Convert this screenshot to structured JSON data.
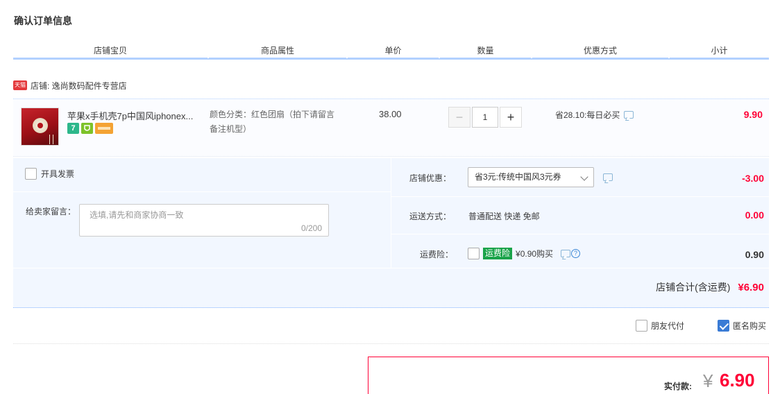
{
  "page_title": "确认订单信息",
  "table_headers": [
    "店铺宝贝",
    "商品属性",
    "单价",
    "数量",
    "优惠方式",
    "小计"
  ],
  "shop": {
    "badge": "天猫",
    "label": "店铺: 逸尚数码配件专营店"
  },
  "item": {
    "title": "苹果x手机壳7p中国风iphonex...",
    "attr_line1": "颜色分类：红色团扇（拍下请留言",
    "attr_line2": "备注机型）",
    "price": "38.00",
    "quantity": "1",
    "minus": "−",
    "plus": "+",
    "promo": "省28.10:每日必买",
    "subtotal": "9.90",
    "icons": [
      "seven-day-return-icon",
      "guarantee-icon",
      "credit-card-icon"
    ],
    "icon_seven_text": "7"
  },
  "invoice_label": "开具发票",
  "message": {
    "label": "给卖家留言：",
    "placeholder": "选填,请先和商家协商一致",
    "counter": "0/200"
  },
  "shop_discount": {
    "label": "店铺优惠：",
    "selected": "省3元:传统中国风3元券",
    "value": "-3.00"
  },
  "shipping": {
    "label": "运送方式：",
    "method": "普通配送 快递 免邮",
    "value": "0.00"
  },
  "insurance": {
    "label": "运费险：",
    "tag": "运费险",
    "amount": "¥0.90购买",
    "value": "0.90",
    "help": "?"
  },
  "shop_total": {
    "label": "店铺合计(含运费)",
    "value": "¥6.90"
  },
  "options": {
    "friend_pay": "朋友代付",
    "anonymous": "匿名购买"
  },
  "payment": {
    "label": "实付款:",
    "currency": "¥",
    "value": "6.90"
  },
  "colors": {
    "accent_red": "#ff0036",
    "header_line": "#b2d1ff",
    "panel_bg": "#f2f7ff",
    "check_blue": "#3a7bd5"
  }
}
